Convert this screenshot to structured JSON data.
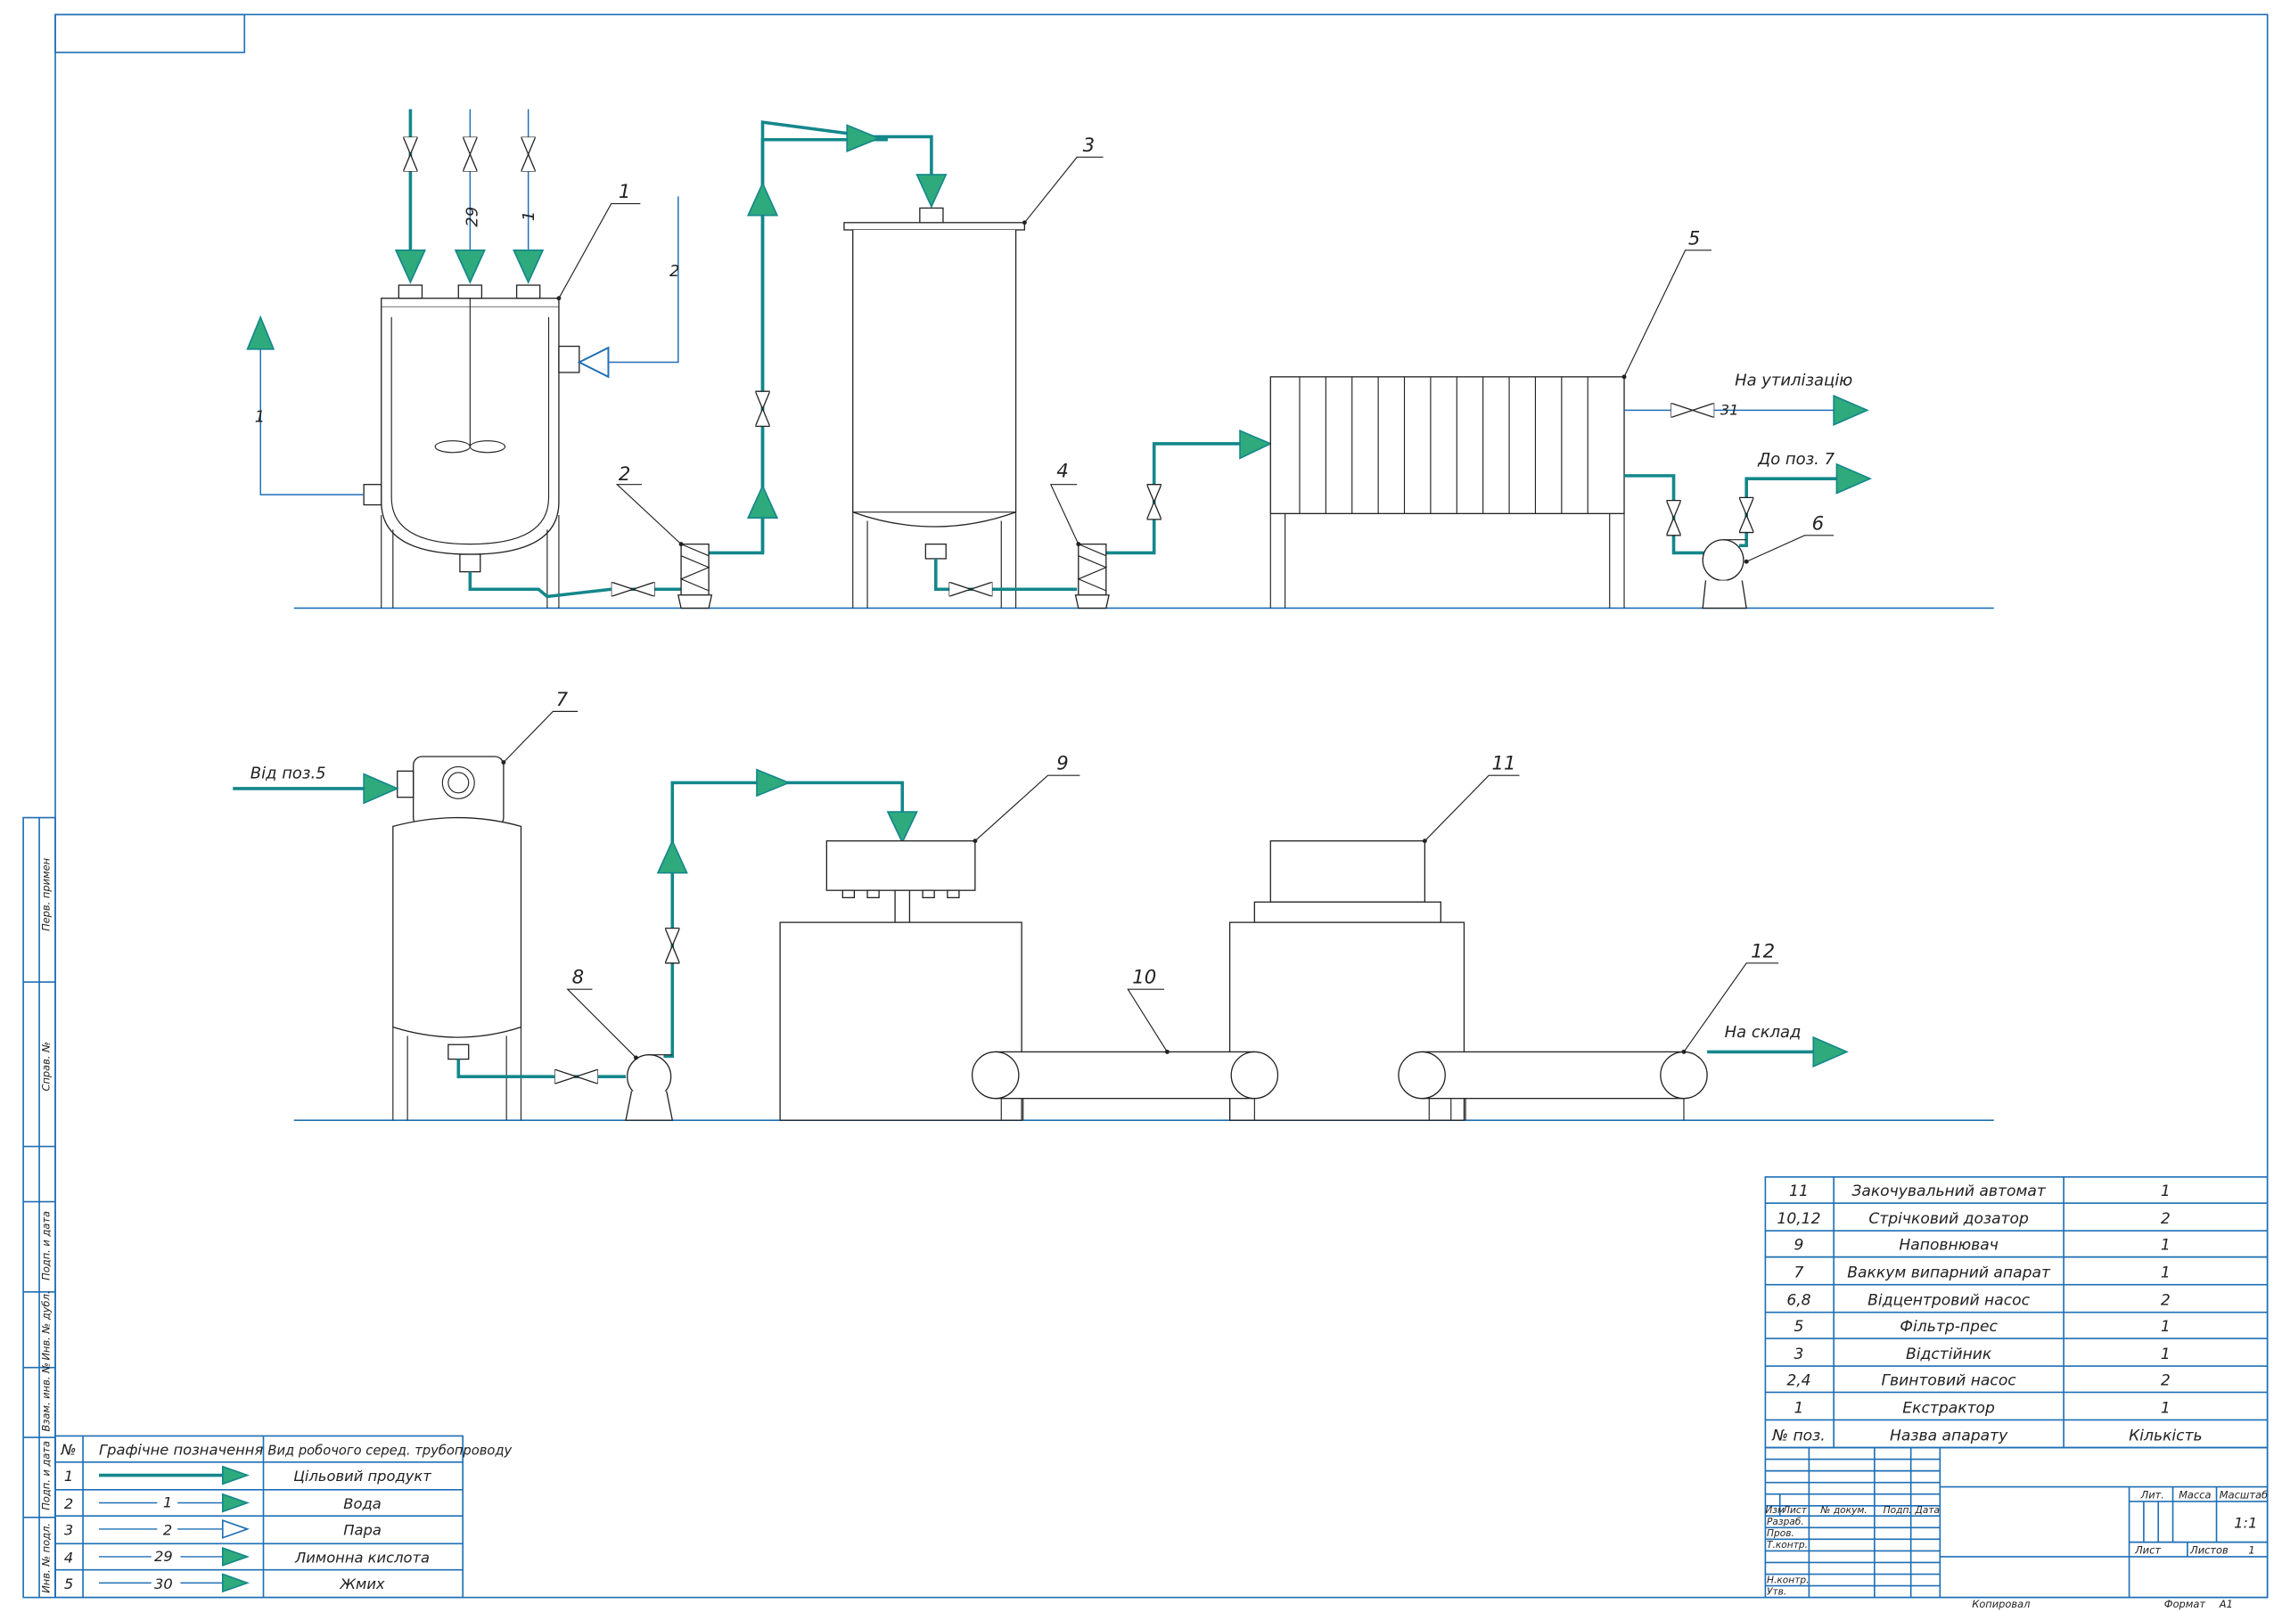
{
  "colors": {
    "frame": "#1e6fb5",
    "product_pipe": "#14878b",
    "arrow_fill": "#2eaa7c",
    "line": "#222222"
  },
  "icons": {
    "flow_arrow": "filled-triangle-arrow",
    "steam_arrow": "hollow-triangle-arrow",
    "valve": "bowtie-valve-icon",
    "pump": "circle-pump-icon"
  },
  "diagram": {
    "position_labels": [
      "1",
      "2",
      "3",
      "4",
      "5",
      "6",
      "7",
      "8",
      "9",
      "10",
      "11",
      "12"
    ],
    "line_labels": {
      "inlet_29": "29",
      "inlet_1": "1",
      "steam_2": "2",
      "outlet_1": "1",
      "waste_31": "31"
    },
    "destinations": {
      "to_disposal": "На утилізацію",
      "to_pos_7": "До поз. 7",
      "from_pos_5": "Від поз.5",
      "to_storage": "На склад"
    }
  },
  "side_stamps": [
    "Перв. примен",
    "Справ. №",
    "Подп. и дата",
    "Инв. № дубл.",
    "Взам. инв. №",
    "Подп. и дата",
    "Инв. № подл."
  ],
  "legend": {
    "headers": [
      "№",
      "Графічне позначення",
      "Вид робочого серед. трубопроводу"
    ],
    "rows": [
      {
        "n": "1",
        "code": "",
        "name": "Цільовий продукт"
      },
      {
        "n": "2",
        "code": "1",
        "name": "Вода"
      },
      {
        "n": "3",
        "code": "2",
        "name": "Пара"
      },
      {
        "n": "4",
        "code": "29",
        "name": "Лимонна кислота"
      },
      {
        "n": "5",
        "code": "30",
        "name": "Жмих"
      }
    ]
  },
  "spec_table": {
    "rows": [
      {
        "pos": "11",
        "name": "Закочувальний автомат",
        "qty": "1"
      },
      {
        "pos": "10,12",
        "name": "Стрічковий дозатор",
        "qty": "2"
      },
      {
        "pos": "9",
        "name": "Наповнювач",
        "qty": "1"
      },
      {
        "pos": "7",
        "name": "Ваккум випарний апарат",
        "qty": "1"
      },
      {
        "pos": "6,8",
        "name": "Відцентровий насос",
        "qty": "2"
      },
      {
        "pos": "5",
        "name": "Фільтр-прес",
        "qty": "1"
      },
      {
        "pos": "3",
        "name": "Відстійник",
        "qty": "1"
      },
      {
        "pos": "2,4",
        "name": "Гвинтовий насос",
        "qty": "2"
      },
      {
        "pos": "1",
        "name": "Екстрактор",
        "qty": "1"
      }
    ],
    "header": {
      "pos": "№ поз.",
      "name": "Назва апарату",
      "qty": "Кількість"
    }
  },
  "title_block": {
    "col_labels": [
      "Изм",
      "Лист",
      "№ докум.",
      "Подп.",
      "Дата"
    ],
    "row_labels": [
      "Разраб.",
      "Пров.",
      "Т.контр.",
      "Н.контр.",
      "Утв."
    ],
    "lit": "Лит.",
    "mass": "Масса",
    "scale": "Масштаб",
    "scale_value": "1:1",
    "sheet": "Лист",
    "sheets": "Листов",
    "sheets_value": "1",
    "copied": "Копировал",
    "format": "Формат",
    "format_value": "A1"
  }
}
